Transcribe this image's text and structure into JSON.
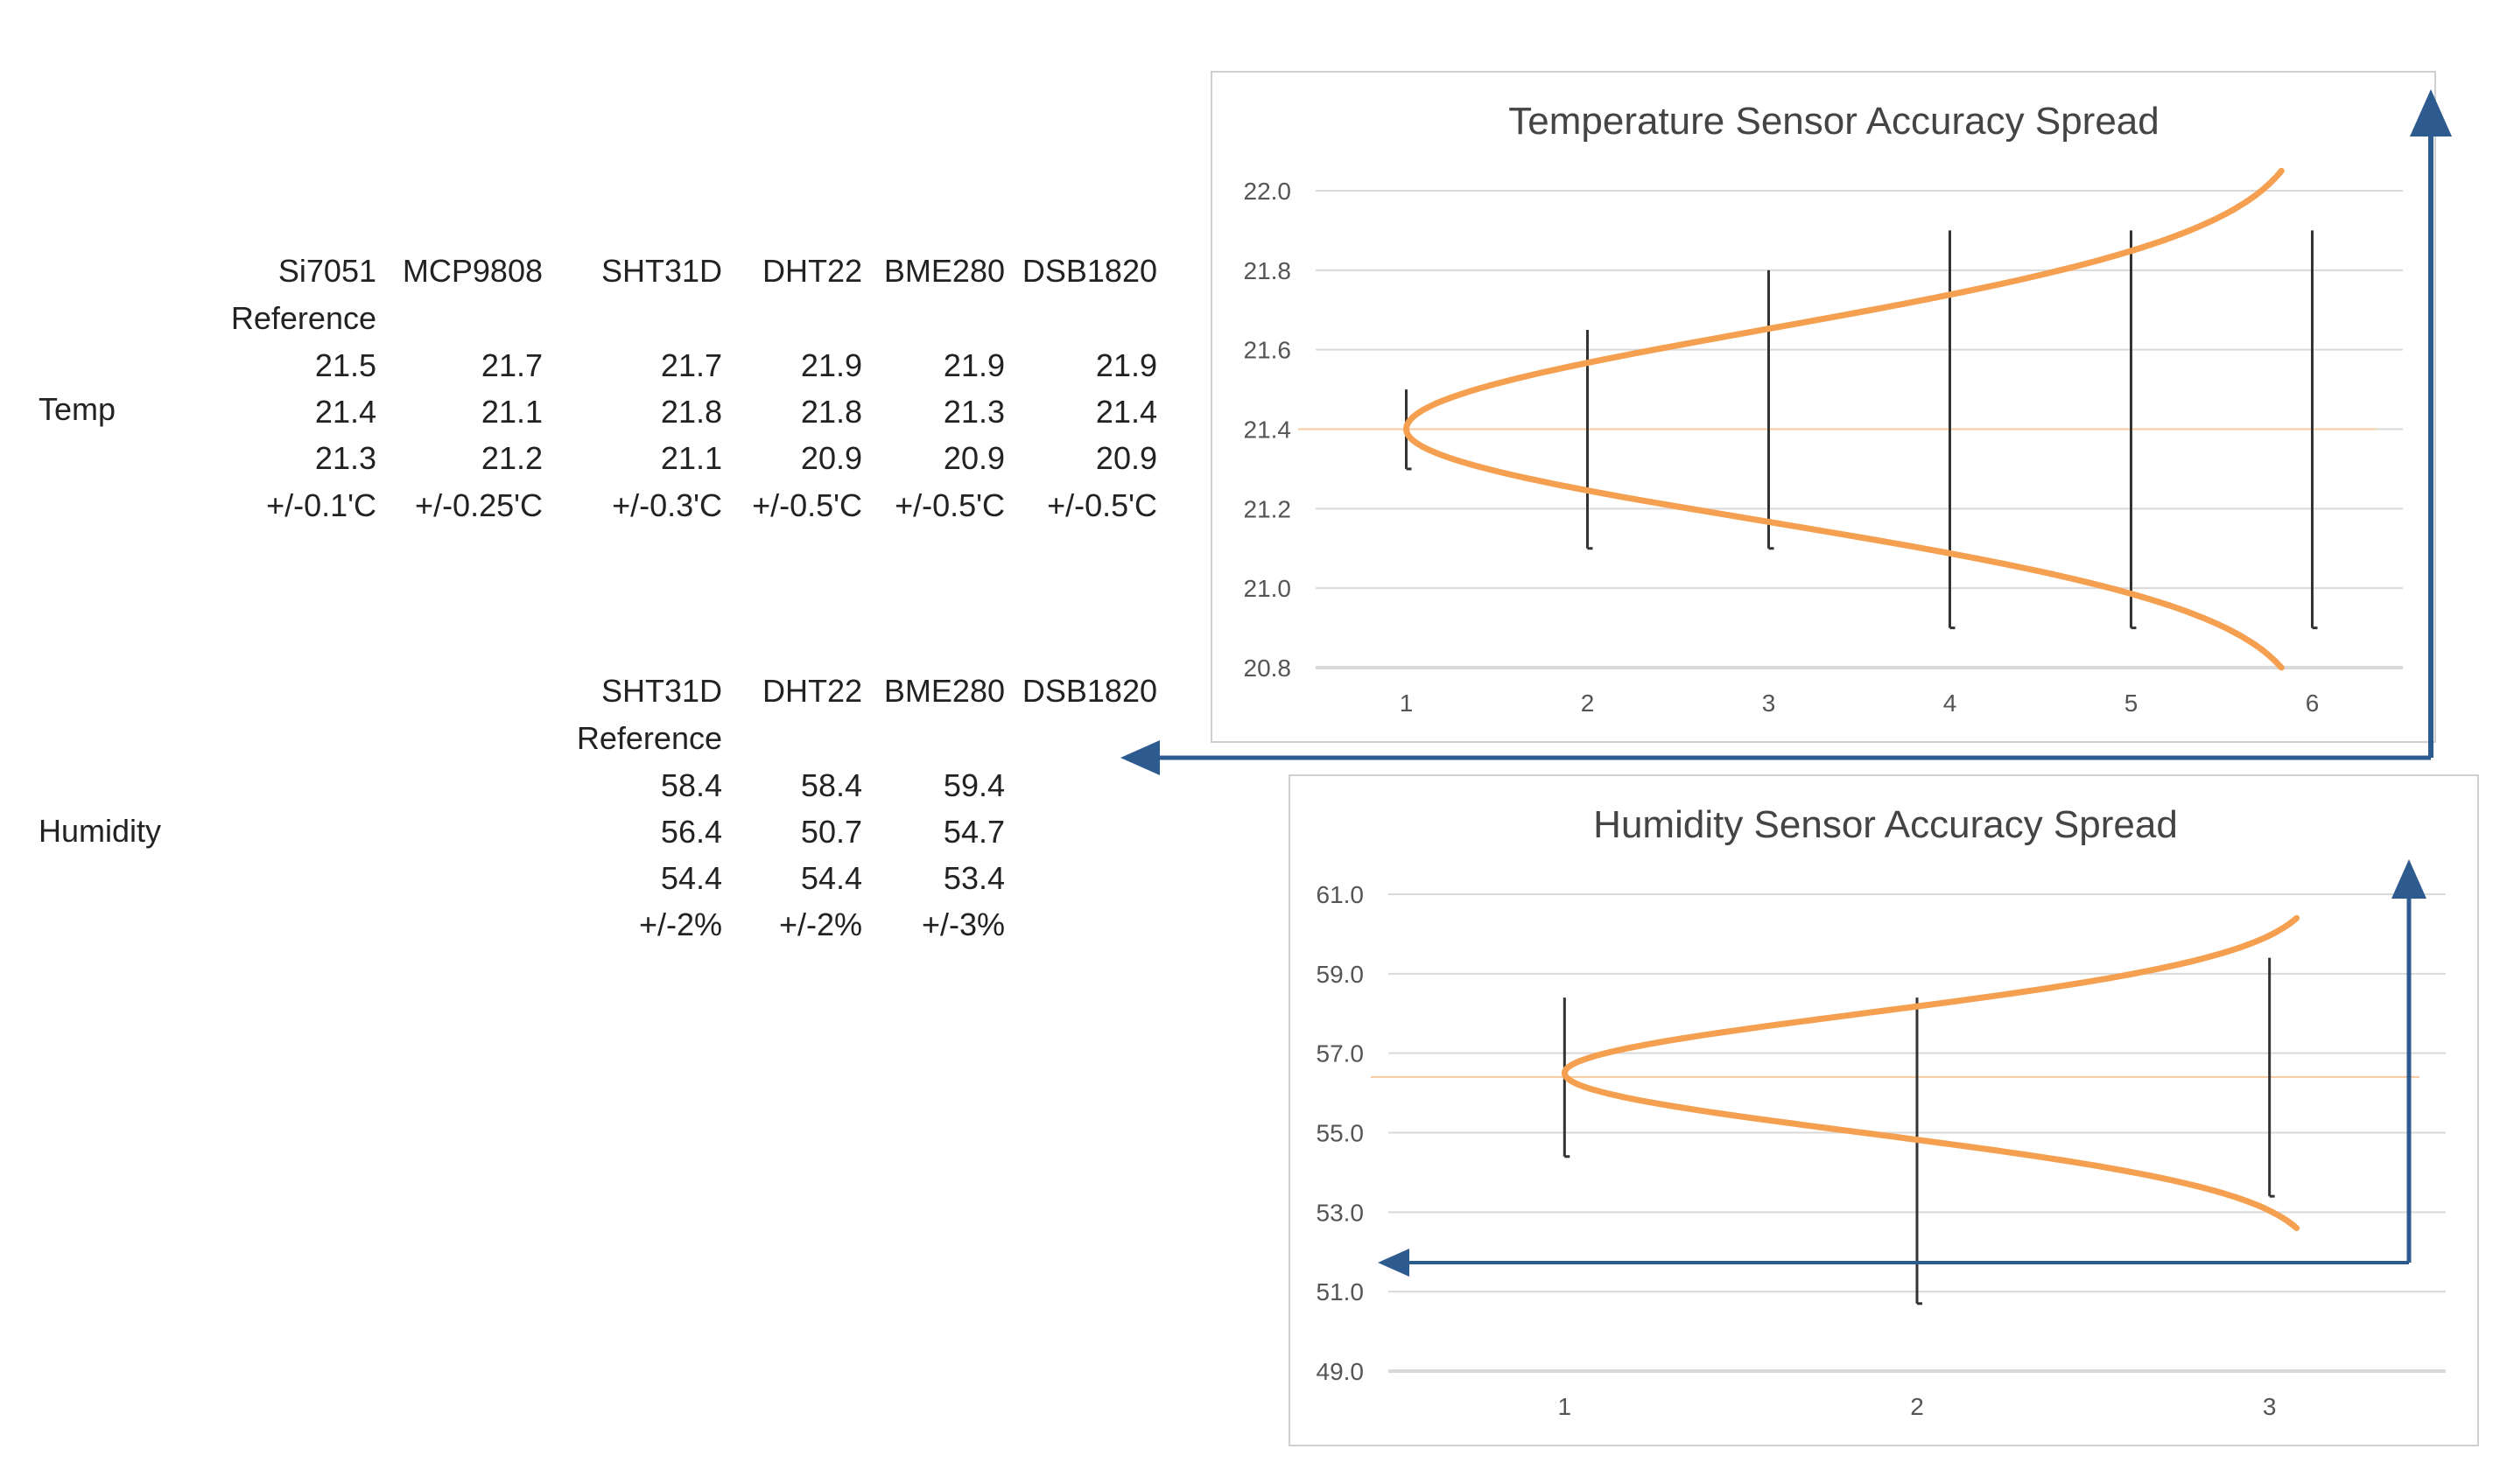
{
  "tables": {
    "temp": {
      "row_label": "Temp",
      "headers": [
        "Si7051",
        "MCP9808",
        "SHT31D",
        "DHT22",
        "BME280",
        "DSB1820"
      ],
      "header_sub": "Reference",
      "rows": [
        [
          "21.5",
          "21.7",
          "21.7",
          "21.9",
          "21.9",
          "21.9"
        ],
        [
          "21.4",
          "21.1",
          "21.8",
          "21.8",
          "21.3",
          "21.4"
        ],
        [
          "21.3",
          "21.2",
          "21.1",
          "20.9",
          "20.9",
          "20.9"
        ],
        [
          "+/-0.1'C",
          "+/-0.25'C",
          "+/-0.3'C",
          "+/-0.5'C",
          "+/-0.5'C",
          "+/-0.5'C"
        ]
      ]
    },
    "humidity": {
      "row_label": "Humidity",
      "headers": [
        "SHT31D",
        "DHT22",
        "BME280",
        "DSB1820"
      ],
      "header_sub": "Reference",
      "rows": [
        [
          "58.4",
          "58.4",
          "59.4"
        ],
        [
          "56.4",
          "50.7",
          "54.7"
        ],
        [
          "54.4",
          "54.4",
          "53.4"
        ],
        [
          "+/-2%",
          "+/-2%",
          "+/-3%"
        ]
      ]
    }
  },
  "colors": {
    "curve": "#f5a050",
    "errbar": "#333333",
    "grid": "#d9d9d9",
    "arrow": "#2e5b8f",
    "refline": "#f7c9a0"
  },
  "chart_data": [
    {
      "type": "line",
      "title": "Temperature Sensor Accuracy Spread",
      "categories": [
        "1",
        "2",
        "3",
        "4",
        "5",
        "6"
      ],
      "ylim": [
        20.8,
        22.0
      ],
      "yticks": [
        "22.0",
        "21.8",
        "21.6",
        "21.4",
        "21.2",
        "21.0",
        "20.8"
      ],
      "ytick_values": [
        22.0,
        21.8,
        21.6,
        21.4,
        21.2,
        21.0,
        20.8
      ],
      "grid": true,
      "error_bars": [
        {
          "x": 1,
          "high": 21.5,
          "low": 21.3
        },
        {
          "x": 2,
          "high": 21.65,
          "low": 21.1
        },
        {
          "x": 3,
          "high": 21.8,
          "low": 21.1
        },
        {
          "x": 4,
          "high": 21.9,
          "low": 20.9
        },
        {
          "x": 5,
          "high": 21.9,
          "low": 20.9
        },
        {
          "x": 6,
          "high": 21.9,
          "low": 20.9
        }
      ],
      "reference_value": 21.4,
      "curve": {
        "peak_y": 21.4,
        "x_min": 1.0,
        "x_max": 6.0,
        "y_low": 20.8,
        "y_high": 22.05
      }
    },
    {
      "type": "line",
      "title": "Humidity Sensor Accuracy Spread",
      "categories": [
        "1",
        "2",
        "3"
      ],
      "ylim": [
        49.0,
        61.0
      ],
      "yticks": [
        "61.0",
        "59.0",
        "57.0",
        "55.0",
        "53.0",
        "51.0",
        "49.0"
      ],
      "ytick_values": [
        61.0,
        59.0,
        57.0,
        55.0,
        53.0,
        51.0,
        49.0
      ],
      "grid": true,
      "error_bars": [
        {
          "x": 1,
          "high": 58.4,
          "low": 54.4
        },
        {
          "x": 2,
          "high": 58.4,
          "low": 50.7
        },
        {
          "x": 3,
          "high": 59.4,
          "low": 53.4
        }
      ],
      "reference_value": 56.4,
      "curve": {
        "peak_y": 56.5,
        "x_min": 1.0,
        "x_max": 3.15,
        "y_low": 52.6,
        "y_high": 60.4
      }
    }
  ]
}
